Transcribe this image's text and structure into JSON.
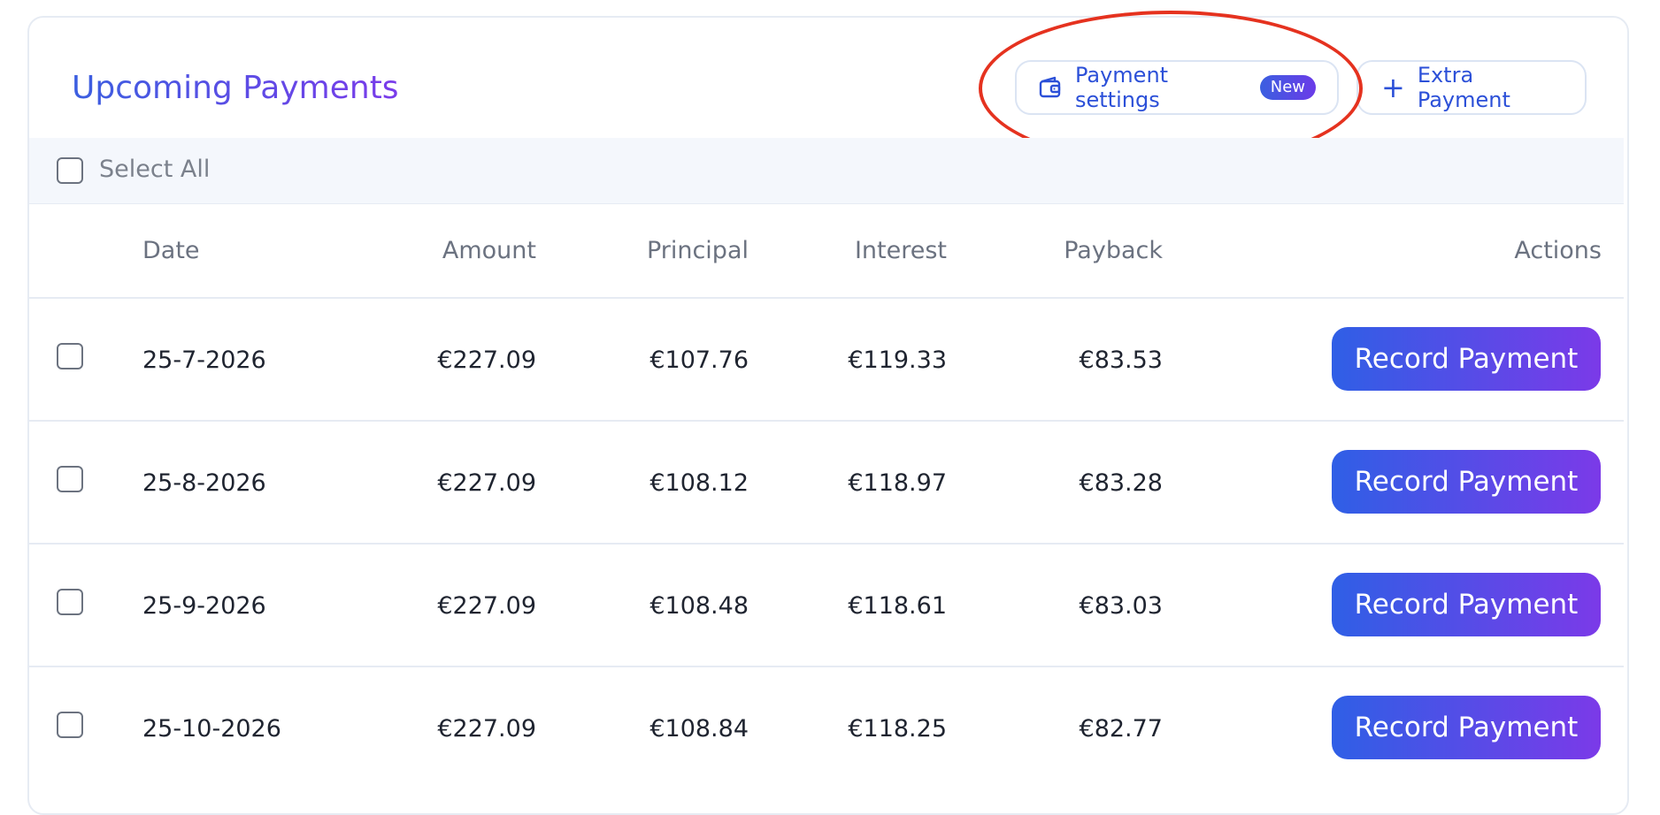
{
  "header": {
    "title": "Upcoming Payments",
    "settings_button": "Payment settings",
    "settings_badge": "New",
    "extra_button_icon": "+",
    "extra_button": "Extra Payment"
  },
  "select_all_label": "Select All",
  "columns": {
    "date": "Date",
    "amount": "Amount",
    "principal": "Principal",
    "interest": "Interest",
    "payback": "Payback",
    "actions": "Actions"
  },
  "rows": [
    {
      "date": "25-7-2026",
      "amount": "€227.09",
      "principal": "€107.76",
      "interest": "€119.33",
      "payback": "€83.53",
      "action": "Record Payment"
    },
    {
      "date": "25-8-2026",
      "amount": "€227.09",
      "principal": "€108.12",
      "interest": "€118.97",
      "payback": "€83.28",
      "action": "Record Payment"
    },
    {
      "date": "25-9-2026",
      "amount": "€227.09",
      "principal": "€108.48",
      "interest": "€118.61",
      "payback": "€83.03",
      "action": "Record Payment"
    },
    {
      "date": "25-10-2026",
      "amount": "€227.09",
      "principal": "€108.84",
      "interest": "€118.25",
      "payback": "€82.77",
      "action": "Record Payment"
    }
  ],
  "icons": {
    "settings": "wallet-icon",
    "extra": "plus-icon"
  },
  "colors": {
    "accent": "#2c50d8",
    "gradient_start": "#2f5fe6",
    "gradient_end": "#7b3ae8",
    "annotation": "#e5321f"
  }
}
